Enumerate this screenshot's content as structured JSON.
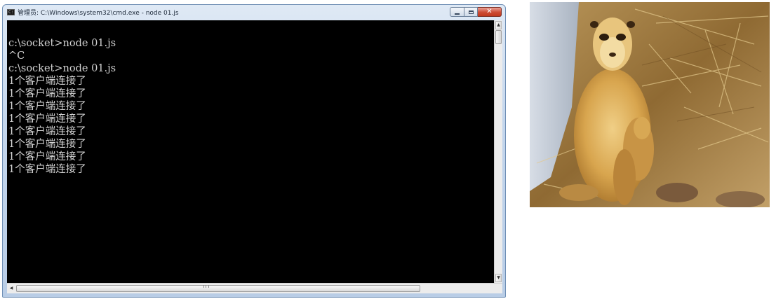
{
  "window": {
    "title": "管理员: C:\\Windows\\system32\\cmd.exe - node  01.js",
    "icon": "cmd-icon",
    "controls": {
      "minimize_icon": "minimize-icon",
      "maximize_icon": "maximize-icon",
      "close_icon": "close-icon",
      "close_glyph": "✕"
    }
  },
  "console": {
    "lines": [
      "c:\\socket>node 01.js",
      "^C",
      "c:\\socket>node 01.js",
      "1个客户端连接了",
      "1个客户端连接了",
      "1个客户端连接了",
      "1个客户端连接了",
      "1个客户端连接了",
      "1个客户端连接了",
      "1个客户端连接了",
      "1个客户端连接了"
    ],
    "background": "#000000",
    "text_color": "#d2d2d2"
  },
  "scrollbars": {
    "up_arrow": "▲",
    "down_arrow": "▼",
    "left_arrow": "◀",
    "right_arrow": "▶"
  },
  "photo": {
    "subject": "meerkat-photo"
  }
}
